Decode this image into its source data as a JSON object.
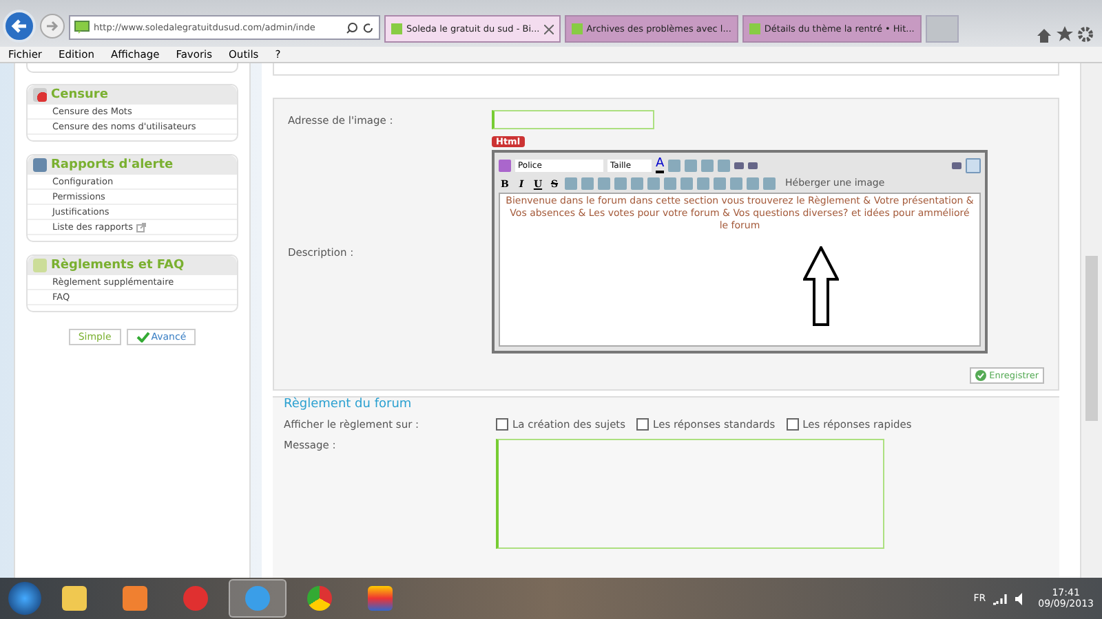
{
  "browser": {
    "url": "http://www.soledalegratuitdusud.com/admin/inde",
    "tabs": [
      {
        "title": "Soleda le gratuit du sud - Bi...",
        "selected": true
      },
      {
        "title": "Archives des problèmes avec l...",
        "selected": false
      },
      {
        "title": "Détails du thème la rentré • Hit...",
        "selected": false
      }
    ],
    "menu": [
      "Fichier",
      "Edition",
      "Affichage",
      "Favoris",
      "Outils",
      "?"
    ]
  },
  "sidebar": {
    "sections": [
      {
        "title": "Censure",
        "items": [
          {
            "label": "Censure des Mots",
            "external": false
          },
          {
            "label": "Censure des noms d'utilisateurs",
            "external": false
          }
        ]
      },
      {
        "title": "Rapports d'alerte",
        "items": [
          {
            "label": "Configuration",
            "external": false
          },
          {
            "label": "Permissions",
            "external": false
          },
          {
            "label": "Justifications",
            "external": false
          },
          {
            "label": "Liste des rapports",
            "external": true
          }
        ]
      },
      {
        "title": "Règlements et FAQ",
        "items": [
          {
            "label": "Règlement supplémentaire",
            "external": false
          },
          {
            "label": "FAQ",
            "external": false
          }
        ]
      }
    ],
    "modes": [
      {
        "label": "Simple",
        "selected": false
      },
      {
        "label": "Avancé",
        "selected": true
      }
    ]
  },
  "image_form": {
    "address_label": "Adresse de l'image :",
    "html_badge": "Html",
    "description_label": "Description :",
    "editor": {
      "font_select": "Police",
      "size_select": "Taille",
      "font_color": "A",
      "format_buttons": [
        "B",
        "I",
        "U",
        "S"
      ],
      "host_image_button": "Héberger une image",
      "content": "Bienvenue dans le forum dans cette section vous trouverez le Règlement & Votre présentation & Vos absences & Les votes pour votre forum & Vos questions diverses? et idées pour ammélioré le forum"
    },
    "save_button": "Enregistrer"
  },
  "rules": {
    "title": "Règlement du forum",
    "display_label": "Afficher le règlement sur :",
    "options": [
      {
        "label": "La création des sujets",
        "checked": false
      },
      {
        "label": "Les réponses standards",
        "checked": false
      },
      {
        "label": "Les réponses rapides",
        "checked": false
      }
    ],
    "message_label": "Message :"
  },
  "taskbar": {
    "language": "FR",
    "time": "17:41",
    "date": "09/09/2013"
  }
}
